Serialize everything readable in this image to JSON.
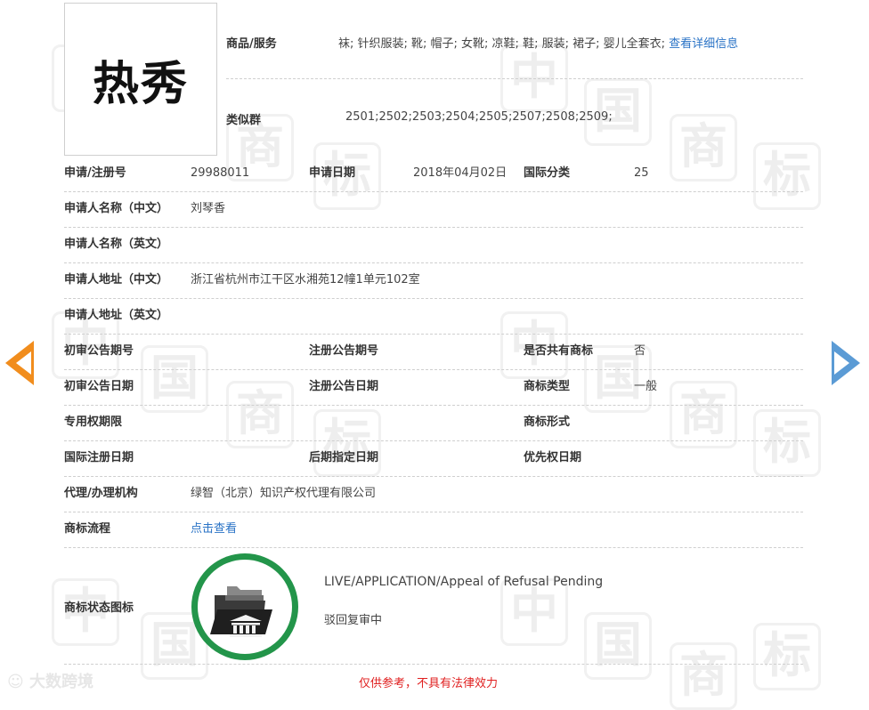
{
  "trademark": {
    "logo_text": "热秀",
    "goods_label": "商品/服务",
    "goods_value": "袜; 针织服装; 靴; 帽子; 女靴; 凉鞋; 鞋; 服装; 裙子; 婴儿全套衣;",
    "goods_link": "查看详细信息",
    "similar_label": "类似群",
    "similar_value": "2501;2502;2503;2504;2505;2507;2508;2509;"
  },
  "details": {
    "reg_no_label": "申请/注册号",
    "reg_no": "29988011",
    "app_date_label": "申请日期",
    "app_date": "2018年04月02日",
    "intl_class_label": "国际分类",
    "intl_class": "25",
    "applicant_cn_label": "申请人名称（中文）",
    "applicant_cn": "刘琴香",
    "applicant_en_label": "申请人名称（英文）",
    "applicant_en": "",
    "address_cn_label": "申请人地址（中文）",
    "address_cn": "浙江省杭州市江干区水湘苑12幢1单元102室",
    "address_en_label": "申请人地址（英文）",
    "address_en": "",
    "prelim_no_label": "初审公告期号",
    "prelim_no": "",
    "reg_pub_no_label": "注册公告期号",
    "reg_pub_no": "",
    "shared_label": "是否共有商标",
    "shared": "否",
    "prelim_date_label": "初审公告日期",
    "prelim_date": "",
    "reg_pub_date_label": "注册公告日期",
    "reg_pub_date": "",
    "tm_type_label": "商标类型",
    "tm_type": "一般",
    "exclusive_label": "专用权期限",
    "exclusive": "",
    "tm_form_label": "商标形式",
    "tm_form": "",
    "intl_reg_date_label": "国际注册日期",
    "intl_reg_date": "",
    "later_date_label": "后期指定日期",
    "later_date": "",
    "priority_label": "优先权日期",
    "priority": "",
    "agent_label": "代理/办理机构",
    "agent": "绿智（北京）知识产权代理有限公司",
    "process_label": "商标流程",
    "process_link": "点击查看",
    "status_label": "商标状态图标",
    "status_en": "LIVE/APPLICATION/Appeal of Refusal Pending",
    "status_cn": "驳回复审中"
  },
  "disclaimer": "仅供参考，不具有法律效力",
  "source_label": "大数跨境",
  "watermark_chars": [
    "中",
    "国",
    "商",
    "标"
  ],
  "colors": {
    "link": "#2a73c6",
    "status_ring": "#23954a",
    "disclaimer": "#e02020",
    "arrow_prev": "#f18d1d",
    "arrow_next": "#5b9bd5"
  }
}
